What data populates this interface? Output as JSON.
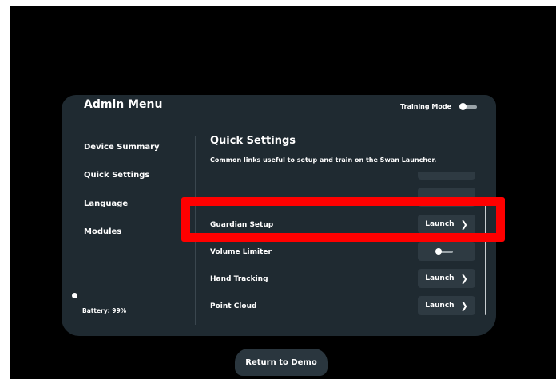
{
  "panel": {
    "title": "Admin Menu",
    "training_mode": {
      "label": "Training Mode",
      "enabled": false
    }
  },
  "sidebar": {
    "items": [
      {
        "label": "Device Summary"
      },
      {
        "label": "Quick Settings"
      },
      {
        "label": "Language"
      },
      {
        "label": "Modules"
      }
    ],
    "battery": "Battery: 99%"
  },
  "main": {
    "title": "Quick Settings",
    "description": "Common links useful to setup and train on the Swan Launcher.",
    "rows": [
      {
        "label": "Guardian Setup",
        "action": "Launch"
      },
      {
        "label": "Volume Limiter",
        "control": "toggle",
        "enabled": false
      },
      {
        "label": "Hand Tracking",
        "action": "Launch"
      },
      {
        "label": "Point Cloud",
        "action": "Launch"
      }
    ],
    "chevron_icon": "chevron-right-icon"
  },
  "footer": {
    "return_label": "Return to Demo"
  },
  "colors": {
    "panel_bg": "#1f2a31",
    "button_bg": "#2e3a42",
    "highlight": "#ff0000"
  }
}
